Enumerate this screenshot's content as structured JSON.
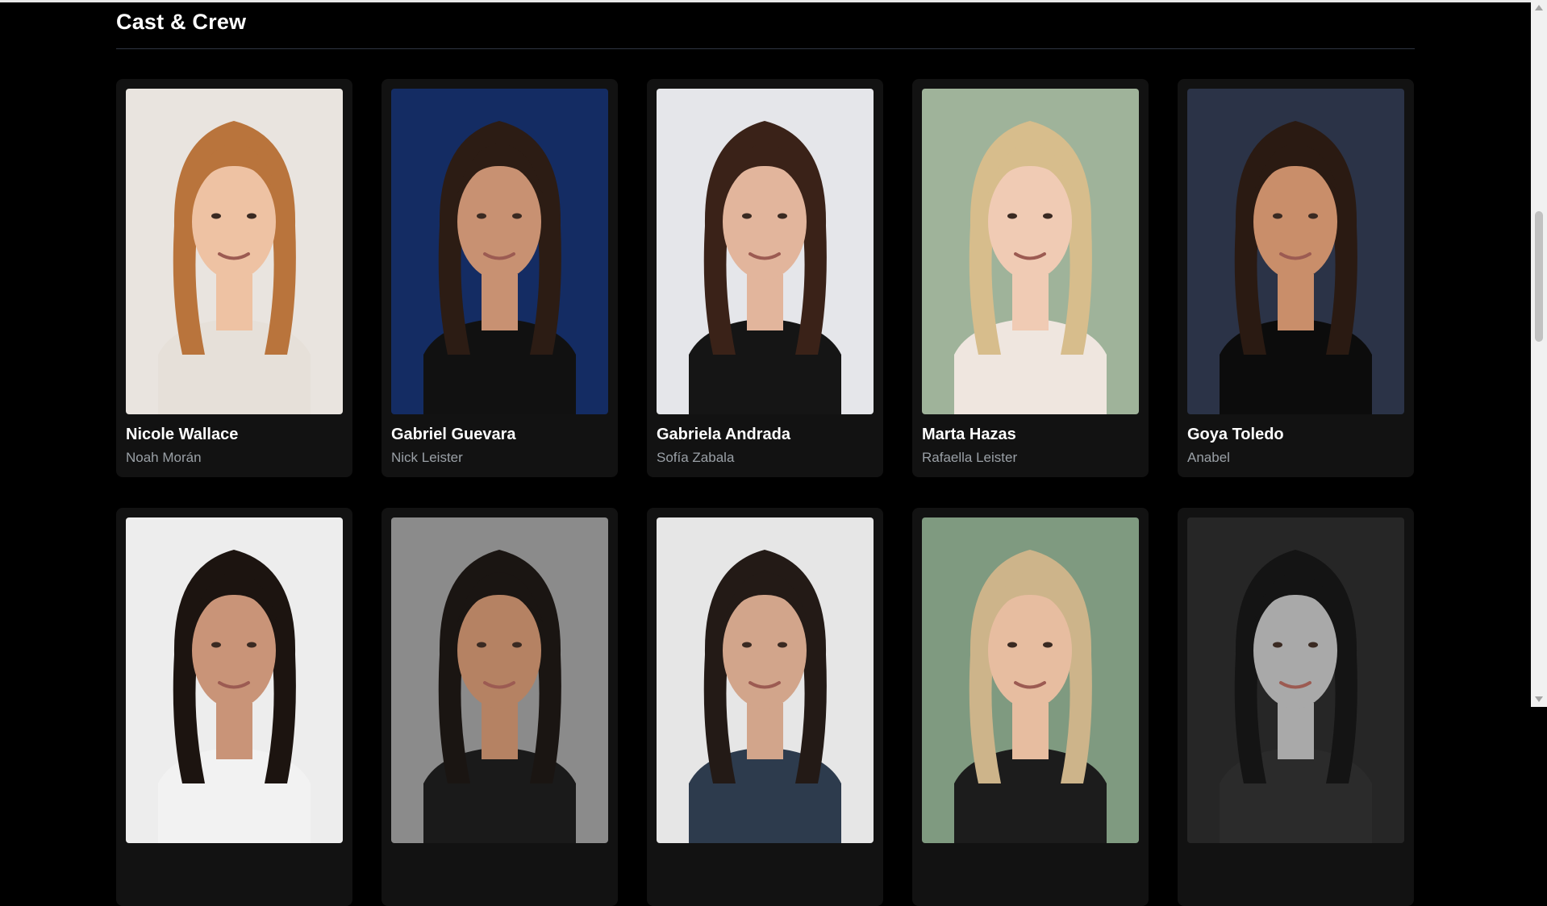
{
  "section": {
    "title": "Cast & Crew"
  },
  "cast": [
    {
      "name": "Nicole Wallace",
      "role": "Noah Morán",
      "photo_bg": "#e9e4df",
      "hair": "#b9743c",
      "skin": "#eec2a3",
      "cloth": "#e6e0d9"
    },
    {
      "name": "Gabriel Guevara",
      "role": "Nick Leister",
      "photo_bg": "#142c63",
      "hair": "#2c1c14",
      "skin": "#c89172",
      "cloth": "#111111"
    },
    {
      "name": "Gabriela Andrada",
      "role": "Sofía Zabala",
      "photo_bg": "#e5e6ea",
      "hair": "#3a2218",
      "skin": "#e2b59c",
      "cloth": "#151515"
    },
    {
      "name": "Marta Hazas",
      "role": "Rafaella Leister",
      "photo_bg": "#9fb39a",
      "hair": "#d7bd8c",
      "skin": "#f0cbb4",
      "cloth": "#efe6df"
    },
    {
      "name": "Goya Toledo",
      "role": "Anabel",
      "photo_bg": "#2b3347",
      "hair": "#2a1a12",
      "skin": "#c98e6a",
      "cloth": "#0c0c0c"
    },
    {
      "name": "",
      "role": "",
      "photo_bg": "#ededed",
      "hair": "#1c1410",
      "skin": "#c99478",
      "cloth": "#f2f2f2"
    },
    {
      "name": "",
      "role": "",
      "photo_bg": "#8b8b8b",
      "hair": "#1a1512",
      "skin": "#b58263",
      "cloth": "#1a1a1a"
    },
    {
      "name": "",
      "role": "",
      "photo_bg": "#e6e6e6",
      "hair": "#231a16",
      "skin": "#d2a58b",
      "cloth": "#2d3b4d"
    },
    {
      "name": "",
      "role": "",
      "photo_bg": "#7f9a80",
      "hair": "#cdb48a",
      "skin": "#e7bda0",
      "cloth": "#1c1c1c"
    },
    {
      "name": "",
      "role": "",
      "photo_bg": "#262626",
      "hair": "#141414",
      "skin": "#a9a9a9",
      "cloth": "#2b2b2b"
    }
  ],
  "scrollbar": {
    "position_percent": 36
  }
}
